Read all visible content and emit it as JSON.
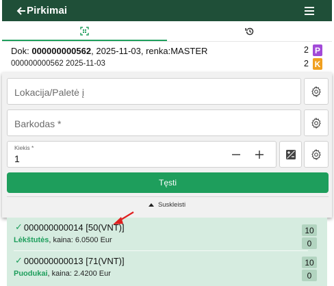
{
  "header": {
    "title": "Pirkimai",
    "back_icon": "arrow-left-icon",
    "menu_icon": "hamburger-menu-icon",
    "bg_color": "#1f4f38"
  },
  "tabs": [
    {
      "icon": "barcode-scan-icon",
      "active": true
    },
    {
      "icon": "history-icon",
      "active": false
    }
  ],
  "document": {
    "prefix": "Dok: ",
    "number": "000000000562",
    "rest": ", 2025-11-03, renka:MASTER",
    "subline": "000000000562 2025-11-03",
    "counters": [
      {
        "count": "2",
        "badge": "P",
        "color": "#a24ad8"
      },
      {
        "count": "2",
        "badge": "K",
        "color": "#f0a020"
      }
    ]
  },
  "form": {
    "location_placeholder": "Lokacija/Paletė į",
    "barcode_placeholder": "Barkodas *",
    "quantity_label": "Kiekis *",
    "quantity_value": "1",
    "continue_label": "Tęsti",
    "collapse_label": "Suskleisti",
    "accent_color": "#1e9e5c"
  },
  "items": [
    {
      "title": "000000000014 [50(VNT)]",
      "name": "Lėkštutės",
      "price_text": ", kaina: 6.0500 Eur",
      "qty_top": "10",
      "qty_bottom": "0"
    },
    {
      "title": "000000000013 [71(VNT)]",
      "name": "Puodukai",
      "price_text": ", kaina: 2.4200 Eur",
      "qty_top": "10",
      "qty_bottom": "0"
    }
  ]
}
